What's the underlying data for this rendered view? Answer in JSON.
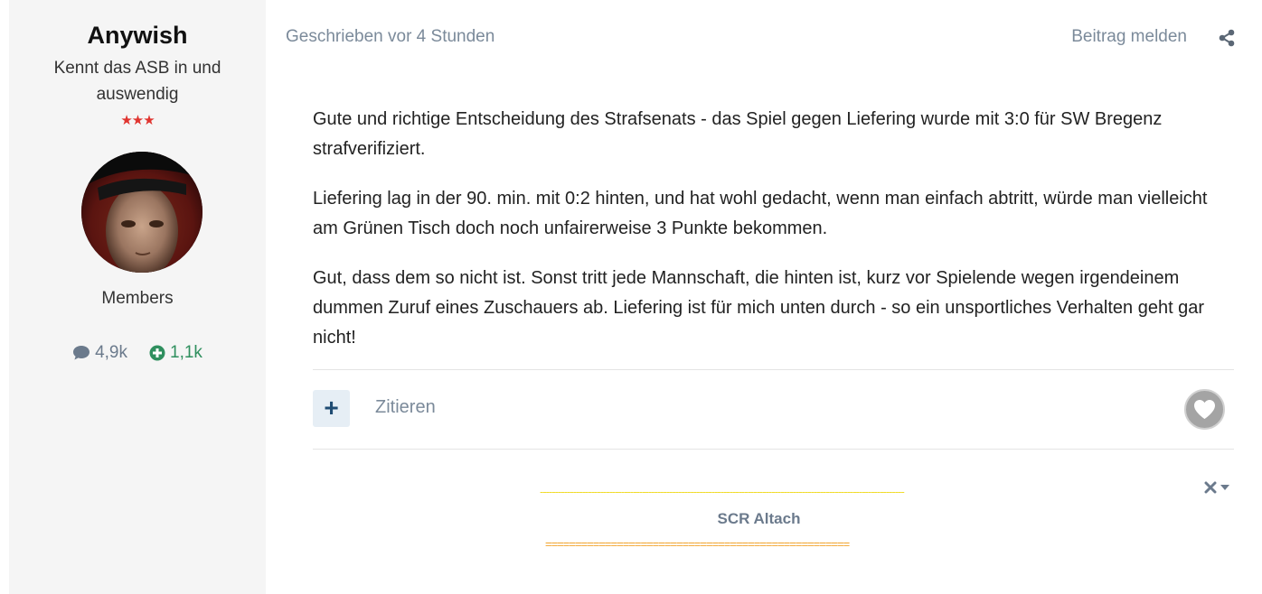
{
  "author": {
    "name": "Anywish",
    "rank": "Kennt das ASB in und auswendig",
    "stars": "★★★",
    "group": "Members",
    "posts_count": "4,9k",
    "reputation": "1,1k"
  },
  "post": {
    "meta": "Geschrieben vor 4 Stunden",
    "report_label": "Beitrag melden",
    "paragraphs": [
      "Gute und richtige Entscheidung des Strafsenats - das Spiel gegen Liefering wurde mit 3:0 für SW Bregenz strafverifiziert.",
      "Liefering lag in der 90. min. mit 0:2 hinten, und hat wohl gedacht, wenn man einfach abtritt, würde man vielleicht am Grünen Tisch doch noch unfairerweise 3 Punkte bekommen.",
      "Gut, dass dem so nicht ist. Sonst tritt jede Mannschaft, die hinten ist, kurz vor Spielende wegen irgendeinem dummen Zuruf eines Zuschauers ab. Liefering ist für mich unten durch - so ein unsportliches Verhalten geht gar nicht!"
    ]
  },
  "actions": {
    "quote_plus": "+",
    "quote_label": "Zitieren"
  },
  "signature": {
    "top_line": "-------------------------------------------------------------------------------------------------------------------------",
    "title": "SCR Altach",
    "bottom_line": "==================================================="
  },
  "icons": {
    "share": "share-icon",
    "like": "heart-icon",
    "posts": "comment-icon",
    "reputation": "plus-circle-icon",
    "sig_close": "close-icon",
    "sig_menu": "caret-down-icon"
  },
  "colors": {
    "panel_bg": "#f5f5f5",
    "muted_text": "#7b8a9a",
    "stars": "#e0342f",
    "reputation": "#2f8f5e",
    "quote_bg": "#e6eef5"
  }
}
